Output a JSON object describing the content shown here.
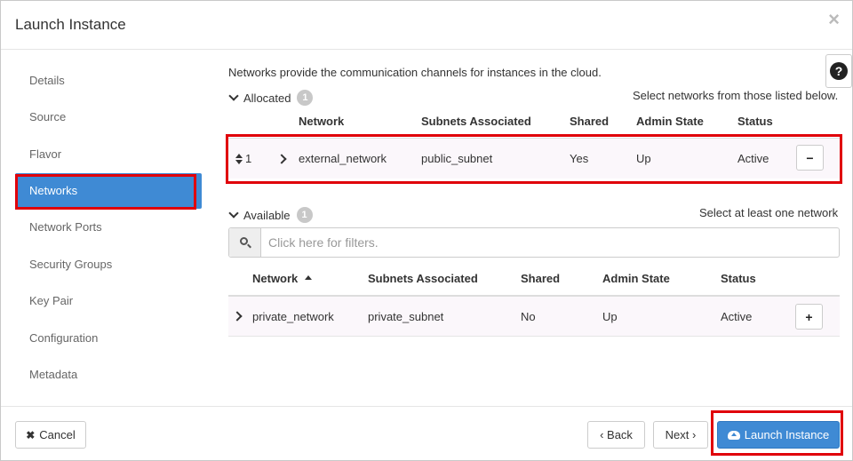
{
  "modal": {
    "title": "Launch Instance",
    "close_glyph": "×"
  },
  "sidebar": {
    "items": [
      {
        "label": "Details"
      },
      {
        "label": "Source"
      },
      {
        "label": "Flavor"
      },
      {
        "label": "Networks",
        "active": true
      },
      {
        "label": "Network Ports"
      },
      {
        "label": "Security Groups"
      },
      {
        "label": "Key Pair"
      },
      {
        "label": "Configuration"
      },
      {
        "label": "Metadata"
      }
    ]
  },
  "content": {
    "intro": "Networks provide the communication channels for instances in the cloud.",
    "help_glyph": "?",
    "allocated": {
      "label": "Allocated",
      "count": "1",
      "hint": "Select networks from those listed below.",
      "columns": [
        "Network",
        "Subnets Associated",
        "Shared",
        "Admin State",
        "Status"
      ],
      "rows": [
        {
          "order": "1",
          "network": "external_network",
          "subnets": "public_subnet",
          "shared": "Yes",
          "admin_state": "Up",
          "status": "Active",
          "action_glyph": "−"
        }
      ]
    },
    "available": {
      "label": "Available",
      "count": "1",
      "hint": "Select at least one network",
      "filter_placeholder": "Click here for filters.",
      "columns": [
        "Network",
        "Subnets Associated",
        "Shared",
        "Admin State",
        "Status"
      ],
      "rows": [
        {
          "network": "private_network",
          "subnets": "private_subnet",
          "shared": "No",
          "admin_state": "Up",
          "status": "Active",
          "action_glyph": "+"
        }
      ]
    }
  },
  "footer": {
    "cancel_label": "Cancel",
    "back_label": "‹ Back",
    "next_label": "Next ›",
    "launch_label": "Launch Instance"
  },
  "colors": {
    "primary": "#3f8ad4",
    "highlight": "#e0000a"
  }
}
